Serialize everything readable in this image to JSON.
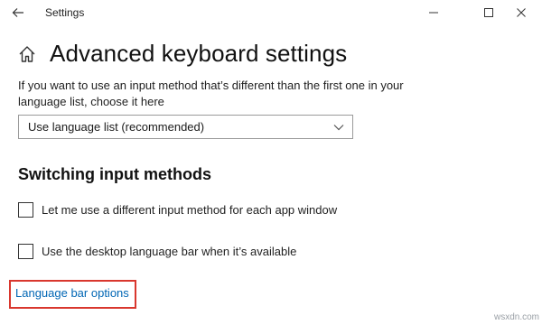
{
  "window": {
    "title": "Settings",
    "back_icon": "back-arrow-icon",
    "controls": [
      "minimize-icon",
      "maximize-icon",
      "close-icon"
    ]
  },
  "header": {
    "home_icon": "home-icon",
    "title": "Advanced keyboard settings"
  },
  "main": {
    "description": "If you want to use an input method that’s different than the first one in your language list, choose it here",
    "dropdown": {
      "selected": "Use language list (recommended)",
      "icon": "chevron-down-icon"
    },
    "section_title": "Switching input methods",
    "options": [
      {
        "label": "Let me use a different input method for each app window",
        "checked": false
      },
      {
        "label": "Use the desktop language bar when it’s available",
        "checked": false
      }
    ],
    "link": "Language bar options",
    "highlight_color": "#d9372e",
    "link_color": "#0066b4"
  },
  "watermark": "wsxdn.com"
}
